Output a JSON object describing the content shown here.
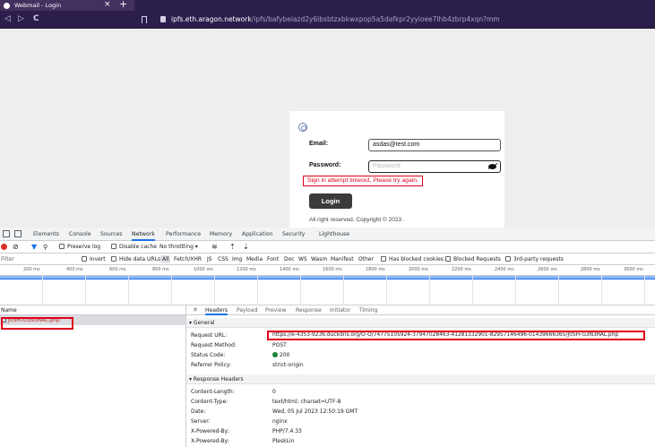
{
  "browser": {
    "tab_title": "Webmail - Login",
    "tab_close": "×",
    "new_tab": "+",
    "nav_back": "◁",
    "nav_forward": "▷",
    "nav_reload": "C",
    "url_host": "ipfs.eth.aragon.network",
    "url_path": "/ipfs/bafybeiazd2y6lbsbtzxbkwxpop5a5dafkpr2yyioee7lhb4zbrp4xqn?mm"
  },
  "login": {
    "email_label": "Email:",
    "email_value": "asdas@test.com",
    "password_label": "Password:",
    "password_placeholder": "Password",
    "error_text": "Sign in attempt timeout, Please try again.",
    "login_button": "Login",
    "copyright": "All right reserved. Copyright © 2023 ."
  },
  "devtools": {
    "tabs": [
      "Elements",
      "Console",
      "Sources",
      "Network",
      "Performance",
      "Memory",
      "Application",
      "Security",
      "Lighthouse"
    ],
    "active_tab": "Network",
    "toolbar1": {
      "preserve_log": "Preserve log",
      "disable_cache": "Disable cache",
      "throttling": "No throttling"
    },
    "toolbar2": {
      "filter": "Filter",
      "invert": "Invert",
      "hide_data_urls": "Hide data URLs",
      "types": [
        "All",
        "Fetch/XHR",
        "JS",
        "CSS",
        "Img",
        "Media",
        "Font",
        "Doc",
        "WS",
        "Wasm",
        "Manifest",
        "Other"
      ],
      "blocked_cookies": "Has blocked cookies",
      "blocked_requests": "Blocked Requests",
      "third_party": "3rd-party requests"
    },
    "timeline_ticks": [
      "200 ms",
      "400 ms",
      "600 ms",
      "800 ms",
      "1000 ms",
      "1200 ms",
      "1400 ms",
      "1600 ms",
      "1800 ms",
      "2000 ms",
      "2200 ms",
      "2400 ms",
      "2600 ms",
      "2800 ms",
      "3000 ms"
    ],
    "list": {
      "header": "Name",
      "request_name": "J0SH-G3N3RAL.php"
    },
    "panel_tabs": [
      "Headers",
      "Payload",
      "Preview",
      "Response",
      "Initiator",
      "Timing"
    ],
    "general_section": "▾ General",
    "general": {
      "request_url_key": "Request URL:",
      "request_url": "https://e-4353-9236.duckdns.org/O-O/74775105924-37947028463-41281332901-82957146496-01439666365/J0SH-G3N3RAL.php",
      "method_key": "Request Method:",
      "method": "POST",
      "status_key": "Status Code:",
      "status": "200",
      "referrer_key": "Referrer Policy:",
      "referrer": "strict-origin"
    },
    "response_section": "▾ Response Headers",
    "response_headers": [
      {
        "key": "Content-Length:",
        "value": "0"
      },
      {
        "key": "Content-Type:",
        "value": "text/html; charset=UTF-8"
      },
      {
        "key": "Date:",
        "value": "Wed, 05 Jul 2023 12:50:19 GMT"
      },
      {
        "key": "Server:",
        "value": "nginx"
      },
      {
        "key": "X-Powered-By:",
        "value": "PHP/7.4.33"
      },
      {
        "key": "X-Powered-By:",
        "value": "PleskLin"
      }
    ]
  }
}
